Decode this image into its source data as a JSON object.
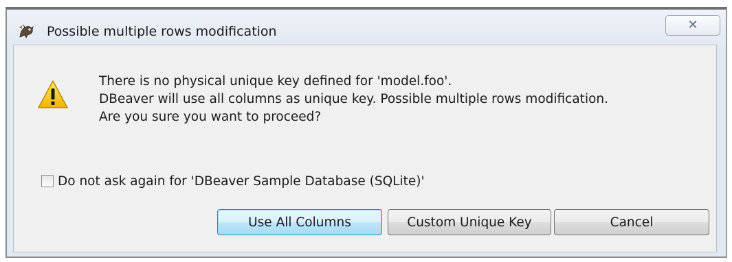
{
  "window": {
    "title": "Possible multiple rows modification",
    "app_icon": "dbeaver-icon",
    "close_icon": "close-icon",
    "close_glyph": "✕"
  },
  "dialog": {
    "icon": "warning-icon",
    "message_lines": [
      "There is no physical unique key defined for  'model.foo'.",
      "DBeaver will use all columns as unique key. Possible multiple rows modification.",
      "Are you sure you want to proceed?"
    ],
    "checkbox": {
      "label": "Do not ask again for 'DBeaver Sample Database (SQLite)'",
      "checked": false
    },
    "buttons": {
      "use_all_columns": "Use All Columns",
      "custom_unique_key": "Custom Unique Key",
      "cancel": "Cancel"
    }
  },
  "colors": {
    "warning_yellow": "#f5c400",
    "default_button_border": "#3c7fb1"
  }
}
